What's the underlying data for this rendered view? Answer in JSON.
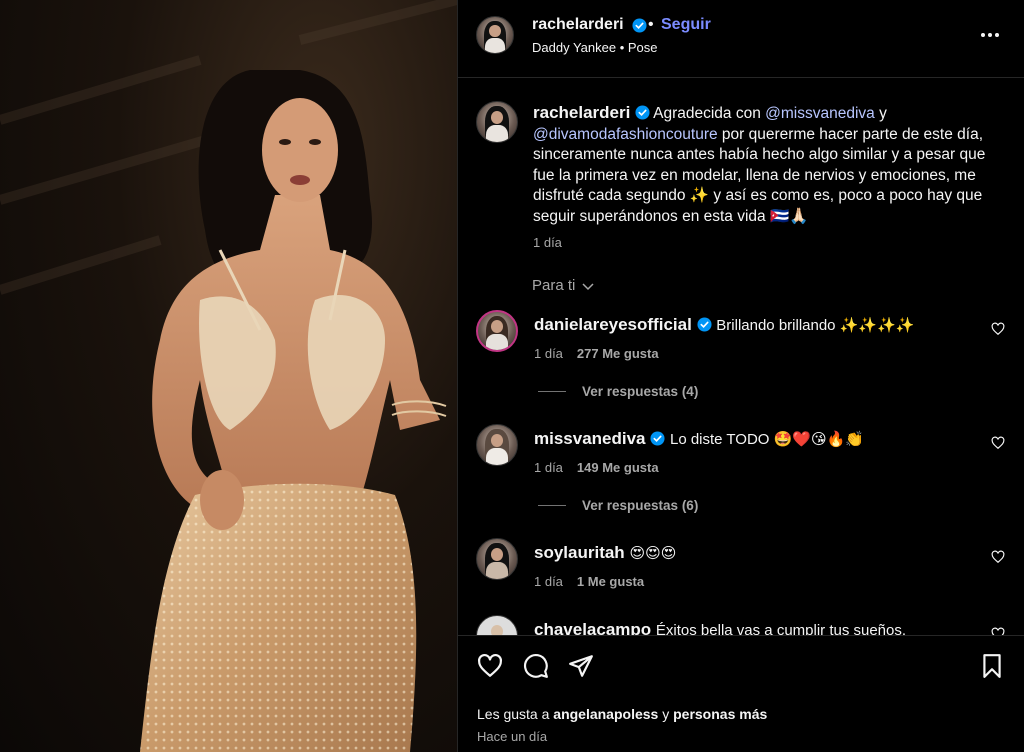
{
  "post": {
    "username": "rachelarderi",
    "follow_label": "Seguir",
    "separator": "•",
    "audio": "Daddy Yankee • Pose",
    "caption": {
      "username": "rachelarderi",
      "text_1": " Agradecida con ",
      "mention_1": "@missvanediva",
      "text_2": " y ",
      "mention_2": "@divamodafashioncouture",
      "text_3": " por quererme hacer parte de este día, sinceramente nunca antes había hecho algo similar y a pesar que fue la primera vez en modelar, llena de nervios y emociones, me disfruté cada segundo ✨ y así es como es, poco a poco hay que seguir superándonos en esta vida 🇨🇺🙏🏻",
      "time": "1 día"
    },
    "sort_label": "Para ti",
    "comments": [
      {
        "username": "danielareyesofficial",
        "verified": true,
        "text": "Brillando brillando ✨✨✨✨",
        "time": "1 día",
        "likes": "277 Me gusta",
        "replies": "Ver respuestas (4)"
      },
      {
        "username": "missvanediva",
        "verified": true,
        "text": "Lo diste TODO 🤩❤️😘🔥👏",
        "time": "1 día",
        "likes": "149 Me gusta",
        "replies": "Ver respuestas (6)"
      },
      {
        "username": "soylauritah",
        "verified": false,
        "text": "😍😍😍",
        "time": "1 día",
        "likes": "1 Me gusta",
        "replies": ""
      },
      {
        "username": "chavelacampo",
        "verified": false,
        "text": "Éxitos bella vas a cumplir tus sueños.",
        "time": "",
        "likes": "",
        "replies": ""
      }
    ],
    "likes_prefix": "Les gusta a ",
    "likes_user": "angelanapoless",
    "likes_mid": " y ",
    "likes_suffix": "personas más",
    "posted": "Hace un día"
  },
  "icons": {
    "verified": "verified-badge-icon",
    "more": "more-options-icon",
    "heart": "heart-icon",
    "comment": "comment-icon",
    "share": "share-icon",
    "save": "bookmark-icon",
    "chevron": "chevron-down-icon"
  },
  "colors": {
    "accent": "#0095f6",
    "follow": "#7b8cff",
    "mention": "#b8c6ff",
    "muted": "#a8a8a8"
  }
}
